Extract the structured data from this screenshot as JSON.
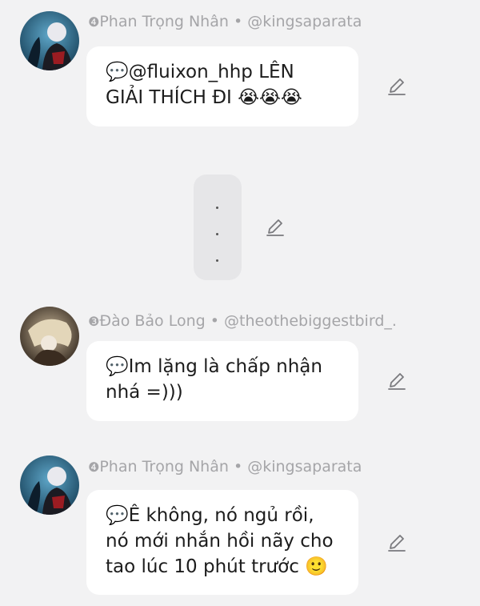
{
  "messages": [
    {
      "author_badge": "4",
      "author_name": "Phan Trọng Nhân",
      "separator": "•",
      "handle": "@kingsaparata",
      "text_line1": "💬@fluixon_hhp LÊN",
      "text_line2": "GIẢI THÍCH ĐI 😭😭😭"
    },
    {
      "author_badge": "3",
      "author_name": "Đào Bảo Long",
      "separator": "•",
      "handle": "@theothebiggestbird_.",
      "text_line1": "💬Im lặng là chấp nhận",
      "text_line2": "nhá =)))"
    },
    {
      "author_badge": "4",
      "author_name": "Phan Trọng Nhân",
      "separator": "•",
      "handle": "@kingsaparata",
      "text_line1": "💬Ê không, nó ngủ rồi,",
      "text_line2": "nó mới nhắn hồi nãy cho",
      "text_line3": "tao lúc 10 phút trước 🙂"
    }
  ],
  "icons": {
    "edit": "pencil-edit-icon",
    "collapsed": "vertical-ellipsis-icon"
  },
  "colors": {
    "background": "#f2f2f3",
    "bubble": "#ffffff",
    "meta_text": "#a5a5a8"
  }
}
